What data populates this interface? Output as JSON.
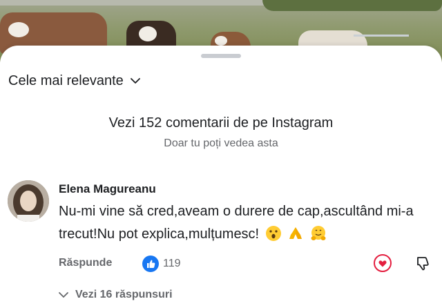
{
  "sort": {
    "label": "Cele mai relevante"
  },
  "instagram": {
    "link_text": "Vezi 152 comentarii de pe Instagram",
    "privacy_note": "Doar tu poți vedea asta"
  },
  "comment": {
    "author": "Elena Magureanu",
    "text": "Nu-mi vine să cred,aveam o durere de cap,ascultând mi-a trecut!Nu pot explica,mulțumesc!",
    "emojis": [
      "astonished-face",
      "folded-hands",
      "hugging-face"
    ],
    "reply_label": "Răspunde",
    "like_count": "119",
    "replies_label": "Vezi 16 răspunsuri"
  },
  "colors": {
    "like_blue": "#1877f2",
    "heart_red": "#e41e3f",
    "secondary_text": "#65676b"
  }
}
